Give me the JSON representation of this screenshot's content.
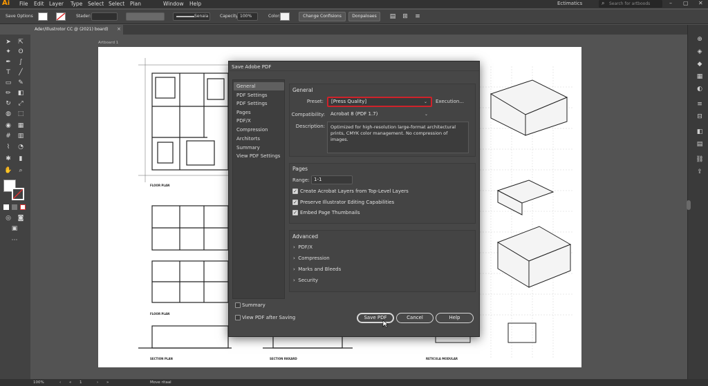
{
  "app": {
    "logo": "Ai",
    "menu": [
      "File",
      "Edit",
      "Layer",
      "Type",
      "Select",
      "Select",
      "Plan",
      "Window",
      "Help"
    ],
    "workspace": "Ectimatics",
    "help_search_placeholder": "Search for artboods",
    "window_controls": [
      "–",
      "▢",
      "✕"
    ]
  },
  "controlbar": {
    "save_options": "Save Options",
    "stroke_label": "Stader:",
    "stroke_profile": "Senaia",
    "opacity_label": "Capecity:",
    "opacity_value": "100%",
    "color_label": "Color:",
    "change_button": "Change Confisions",
    "download_button": "Donpaloaes",
    "fill_color": "#ffffff",
    "accent_color": "#e03030"
  },
  "tab": {
    "label": "Ader/Illustrotor CC @ (2021) board)",
    "close": "×"
  },
  "artboard": {
    "label": "Artboard 1",
    "plan_labels": [
      "FLOOR PLAN",
      "FLOOR PLAN",
      "SECTION PLAN",
      "SECTION RKKARD",
      "RETICULA MODULAR"
    ]
  },
  "dialog": {
    "title": "Save Adobe PDF",
    "sidebar": [
      "General",
      "PDF Settings",
      "PDF Settings",
      "Pages",
      "PDF/X",
      "Compression",
      "Architorts",
      "Summary",
      "View PDF Settings"
    ],
    "selected_index": 0,
    "general": {
      "heading": "General",
      "preset_label": "Preset:",
      "preset_value": "[Press Quality]",
      "preset_highlight": "#d0222a",
      "execution_link": "Execution...",
      "compat_label": "Compatibility:",
      "compat_value": "Acrobat 8 (PDF 1.7)",
      "desc_label": "Description:",
      "desc_value": "Optimized for high-resolution large-format architectural prints, CMYK color management. No compression of images."
    },
    "pages": {
      "heading": "Pages",
      "range_label": "Range:",
      "range_value": "1-1",
      "options": [
        {
          "label": "Create Acrobat Layers from Top-Level Layers",
          "checked": true
        },
        {
          "label": "Preserve Illustrator Editing Capabilities",
          "checked": true
        },
        {
          "label": "Embed Page Thumbnails",
          "checked": true
        }
      ]
    },
    "advanced": {
      "heading": "Advanced",
      "items": [
        "PDF/X",
        "Compression",
        "Marks and Bleeds",
        "Security"
      ]
    },
    "footer": {
      "summary_label": "Summary",
      "view_pdf_label": "View PDF after Saving",
      "save_button": "Save PDF",
      "cancel_button": "Cancel",
      "help_button": "Help"
    }
  },
  "status": {
    "zoom": "100%",
    "page": "1",
    "tool": "Move ritaal"
  }
}
